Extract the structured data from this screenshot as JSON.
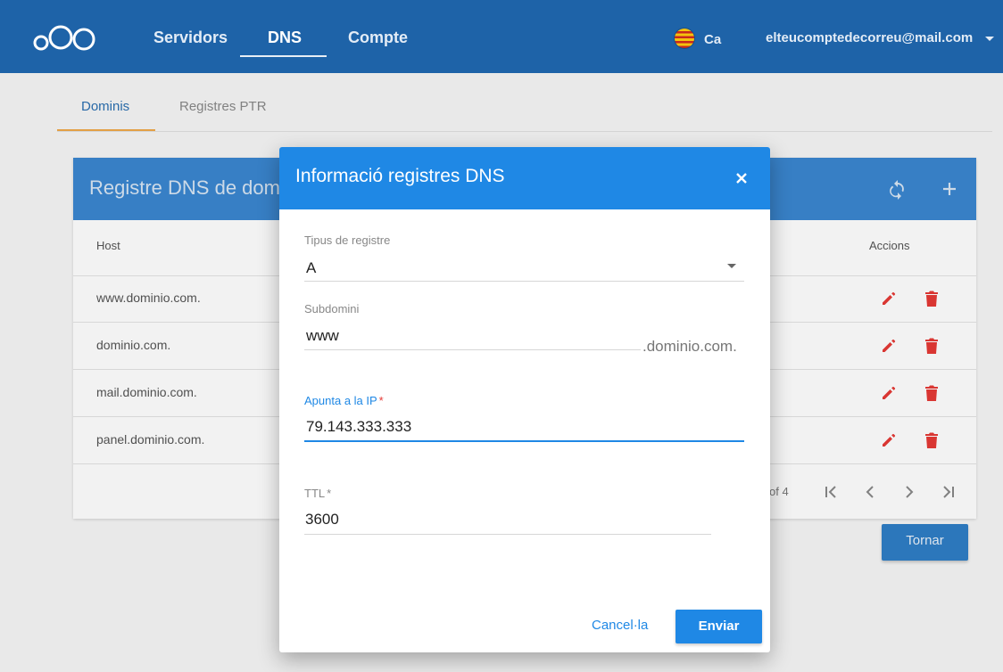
{
  "brand": {
    "logo_icon": "cloud-circles-icon"
  },
  "nav": {
    "items": [
      {
        "label": "Servidors"
      },
      {
        "label": "DNS"
      },
      {
        "label": "Compte"
      }
    ],
    "active": "DNS",
    "language": "Ca",
    "account_email": "elteucomptedecorreu@mail.com"
  },
  "tabs": [
    {
      "label": "Dominis"
    },
    {
      "label": "Registres PTR"
    }
  ],
  "card": {
    "title": "Registre DNS de dom",
    "columns": {
      "host": "Host",
      "actions": "Accions"
    },
    "rows": [
      {
        "host": "www.dominio.com."
      },
      {
        "host": "dominio.com."
      },
      {
        "host": "mail.dominio.com."
      },
      {
        "host": "panel.dominio.com."
      }
    ],
    "pagination_text": "of 4"
  },
  "back_button": "Tornar",
  "modal": {
    "title": "Informació registres DNS",
    "record_type": {
      "label": "Tipus de registre",
      "value": "A"
    },
    "subdomain": {
      "label": "Subdomini",
      "value": "www",
      "suffix": ".dominio.com."
    },
    "ip": {
      "label": "Apunta a la IP",
      "required_mark": "*",
      "value": "79.143.333.333"
    },
    "ttl": {
      "label": "TTL",
      "required_mark": "*",
      "value": "3600"
    },
    "cancel_label": "Cancel·la",
    "submit_label": "Enviar"
  },
  "colors": {
    "topbar": "#1e63a8",
    "modal_header": "#1f88e5",
    "accent": "#1f88e5",
    "tab_indicator": "#f0a84a",
    "delete_red": "#e53935"
  }
}
